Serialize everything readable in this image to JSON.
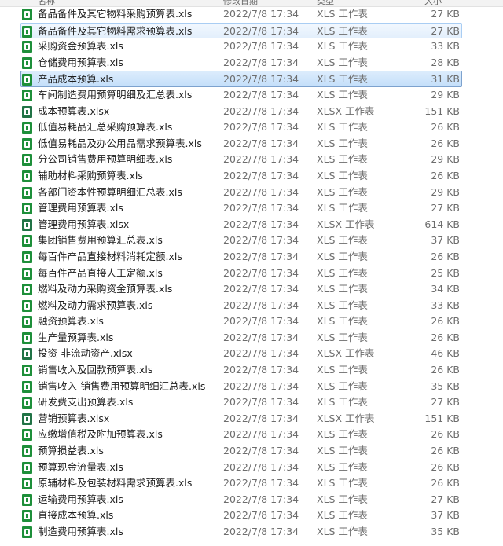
{
  "header": [
    "名称",
    "修改日期",
    "类型",
    "大小"
  ],
  "files": [
    {
      "name": "备品备件及其它物料采购预算表.xls",
      "date": "2022/7/8 17:34",
      "type": "XLS 工作表",
      "size": "27 KB"
    },
    {
      "name": "备品备件及其它物料需求预算表.xls",
      "date": "2022/7/8 17:34",
      "type": "XLS 工作表",
      "size": "27 KB"
    },
    {
      "name": "采购资金预算表.xls",
      "date": "2022/7/8 17:34",
      "type": "XLS 工作表",
      "size": "33 KB"
    },
    {
      "name": "仓储费用预算表.xls",
      "date": "2022/7/8 17:34",
      "type": "XLS 工作表",
      "size": "28 KB"
    },
    {
      "name": "产品成本预算.xls",
      "date": "2022/7/8 17:34",
      "type": "XLS 工作表",
      "size": "31 KB"
    },
    {
      "name": "车间制造费用预算明细及汇总表.xls",
      "date": "2022/7/8 17:34",
      "type": "XLS 工作表",
      "size": "29 KB"
    },
    {
      "name": "成本预算表.xlsx",
      "date": "2022/7/8 17:34",
      "type": "XLSX 工作表",
      "size": "151 KB"
    },
    {
      "name": "低值易耗品汇总采购预算表.xls",
      "date": "2022/7/8 17:34",
      "type": "XLS 工作表",
      "size": "26 KB"
    },
    {
      "name": "低值易耗品及办公用品需求预算表.xls",
      "date": "2022/7/8 17:34",
      "type": "XLS 工作表",
      "size": "26 KB"
    },
    {
      "name": "分公司销售费用预算明细表.xls",
      "date": "2022/7/8 17:34",
      "type": "XLS 工作表",
      "size": "29 KB"
    },
    {
      "name": "辅助材料采购预算表.xls",
      "date": "2022/7/8 17:34",
      "type": "XLS 工作表",
      "size": "26 KB"
    },
    {
      "name": "各部门资本性预算明细汇总表.xls",
      "date": "2022/7/8 17:34",
      "type": "XLS 工作表",
      "size": "29 KB"
    },
    {
      "name": "管理费用预算表.xls",
      "date": "2022/7/8 17:34",
      "type": "XLS 工作表",
      "size": "27 KB"
    },
    {
      "name": "管理费用预算表.xlsx",
      "date": "2022/7/8 17:34",
      "type": "XLSX 工作表",
      "size": "614 KB"
    },
    {
      "name": "集团销售费用预算汇总表.xls",
      "date": "2022/7/8 17:34",
      "type": "XLS 工作表",
      "size": "37 KB"
    },
    {
      "name": "每百件产品直接材料消耗定额.xls",
      "date": "2022/7/8 17:34",
      "type": "XLS 工作表",
      "size": "26 KB"
    },
    {
      "name": "每百件产品直接人工定额.xls",
      "date": "2022/7/8 17:34",
      "type": "XLS 工作表",
      "size": "25 KB"
    },
    {
      "name": "燃料及动力采购资金预算表.xls",
      "date": "2022/7/8 17:34",
      "type": "XLS 工作表",
      "size": "34 KB"
    },
    {
      "name": "燃料及动力需求预算表.xls",
      "date": "2022/7/8 17:34",
      "type": "XLS 工作表",
      "size": "33 KB"
    },
    {
      "name": "融资预算表.xls",
      "date": "2022/7/8 17:34",
      "type": "XLS 工作表",
      "size": "26 KB"
    },
    {
      "name": "生产量预算表.xls",
      "date": "2022/7/8 17:34",
      "type": "XLS 工作表",
      "size": "26 KB"
    },
    {
      "name": "投资-非流动资产.xlsx",
      "date": "2022/7/8 17:34",
      "type": "XLSX 工作表",
      "size": "46 KB"
    },
    {
      "name": "销售收入及回款预算表.xls",
      "date": "2022/7/8 17:34",
      "type": "XLS 工作表",
      "size": "26 KB"
    },
    {
      "name": "销售收入-销售费用预算明细汇总表.xls",
      "date": "2022/7/8 17:34",
      "type": "XLS 工作表",
      "size": "35 KB"
    },
    {
      "name": "研发费支出预算表.xls",
      "date": "2022/7/8 17:34",
      "type": "XLS 工作表",
      "size": "27 KB"
    },
    {
      "name": "营销预算表.xlsx",
      "date": "2022/7/8 17:34",
      "type": "XLSX 工作表",
      "size": "151 KB"
    },
    {
      "name": "应缴增值税及附加预算表.xls",
      "date": "2022/7/8 17:34",
      "type": "XLS 工作表",
      "size": "26 KB"
    },
    {
      "name": "预算损益表.xls",
      "date": "2022/7/8 17:34",
      "type": "XLS 工作表",
      "size": "26 KB"
    },
    {
      "name": "预算现金流量表.xls",
      "date": "2022/7/8 17:34",
      "type": "XLS 工作表",
      "size": "26 KB"
    },
    {
      "name": "原辅材料及包装材料需求预算表.xls",
      "date": "2022/7/8 17:34",
      "type": "XLS 工作表",
      "size": "26 KB"
    },
    {
      "name": "运输费用预算表.xls",
      "date": "2022/7/8 17:34",
      "type": "XLS 工作表",
      "size": "27 KB"
    },
    {
      "name": "直接成本预算.xls",
      "date": "2022/7/8 17:34",
      "type": "XLS 工作表",
      "size": "37 KB"
    },
    {
      "name": "制造费用预算表.xls",
      "date": "2022/7/8 17:34",
      "type": "XLS 工作表",
      "size": "35 KB"
    }
  ],
  "hover_index": 1,
  "selected_index": 4
}
